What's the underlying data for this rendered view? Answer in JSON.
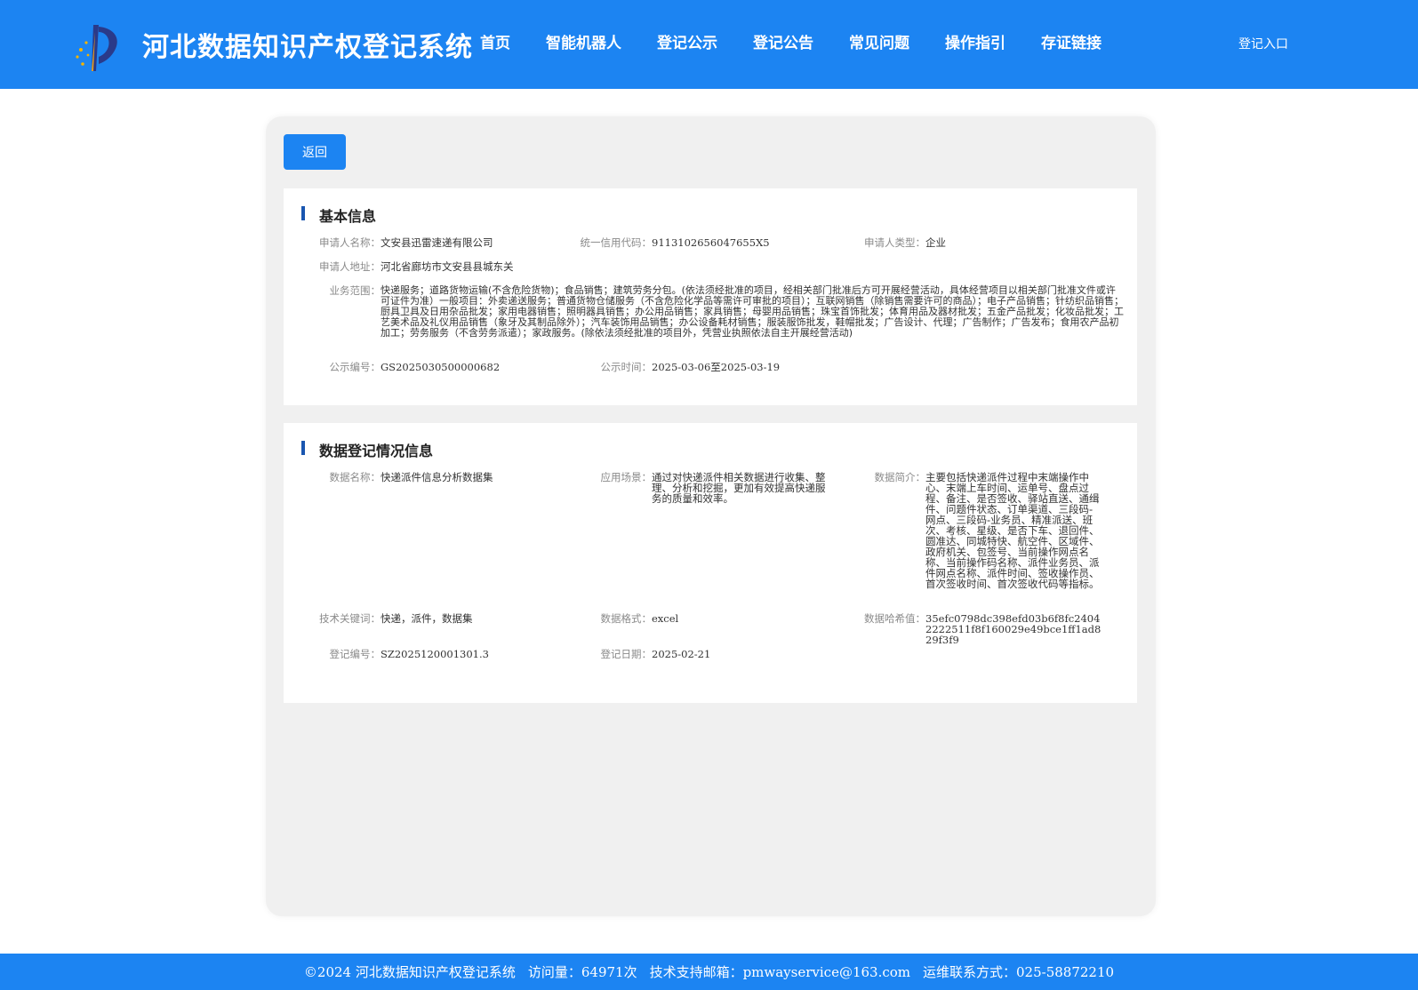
{
  "header": {
    "site_title": "河北数据知识产权登记系统",
    "nav": [
      "首页",
      "智能机器人",
      "登记公示",
      "登记公告",
      "常见问题",
      "操作指引",
      "存证链接"
    ],
    "login": "登记入口"
  },
  "back_label": "返回",
  "basic": {
    "title": "基本信息",
    "applicant_name_label": "申请人名称：",
    "applicant_name": "文安县迅雷速递有限公司",
    "credit_code_label": "统一信用代码：",
    "credit_code": "9113102656047655X5",
    "applicant_type_label": "申请人类型：",
    "applicant_type": "企业",
    "address_label": "申请人地址：",
    "address": "河北省廊坊市文安县县城东关",
    "scope_label": "业务范围：",
    "scope": "快递服务；道路货物运输(不含危险货物)；食品销售；建筑劳务分包。(依法须经批准的项目，经相关部门批准后方可开展经营活动，具体经营项目以相关部门批准文件或许可证件为准）一般项目：外卖递送服务；普通货物仓储服务（不含危险化学品等需许可审批的项目）；互联网销售（除销售需要许可的商品）；电子产品销售；针纺织品销售；厨具卫具及日用杂品批发；家用电器销售；照明器具销售；办公用品销售；家具销售；母婴用品销售；珠宝首饰批发；体育用品及器材批发；五金产品批发；化妆品批发；工艺美术品及礼仪用品销售（象牙及其制品除外）；汽车装饰用品销售；办公设备耗材销售；服装服饰批发，鞋帽批发；广告设计、代理；广告制作；广告发布；食用农产品初加工；劳务服务（不含劳务派遣）；家政服务。(除依法须经批准的项目外，凭营业执照依法自主开展经营活动)",
    "notice_no_label": "公示编号：",
    "notice_no": "GS2025030500000682",
    "notice_time_label": "公示时间：",
    "notice_time": "2025-03-06至2025-03-19"
  },
  "data_info": {
    "title": "数据登记情况信息",
    "data_name_label": "数据名称：",
    "data_name": "快递派件信息分析数据集",
    "scenario_label": "应用场景：",
    "scenario": "通过对快递派件相关数据进行收集、整理、分析和挖掘，更加有效提高快递服务的质量和效率。",
    "intro_label": "数据简介：",
    "intro": "主要包括快递派件过程中末端操作中心、末端上车时间、运单号、盘点过程、备注、是否签收、驿站直送、通缉件、问题件状态、订单渠道、三段码-网点、三段码-业务员、精准派送、班次、考核、星级、是否下车、退回件、圆准达、同城特快、航空件、区域件、政府机关、包签号、当前操作网点名称、当前操作码名称、派件业务员、派件网点名称、派件时间、签收操作员、首次签收时间、首次签收代码等指标。",
    "keywords_label": "技术关键词：",
    "keywords": "快递，派件，数据集",
    "format_label": "数据格式：",
    "format": "excel",
    "hash_label": "数据哈希值：",
    "hash": "35efc0798dc398efd03b6f8fc24042222511f8f160029e49bce1ff1ad829f3f9",
    "reg_no_label": "登记编号：",
    "reg_no": "SZ2025120001301.3",
    "reg_date_label": "登记日期：",
    "reg_date": "2025-02-21"
  },
  "footer": {
    "copyright": "©2024 河北数据知识产权登记系统",
    "visits": "访问量：64971次",
    "email": "技术支持邮箱：pmwayservice@163.com",
    "phone": "运维联系方式：025-58872210"
  },
  "colors": {
    "primary": "#1c84f2",
    "accent_bar": "#1a56b0",
    "card_bg": "#f0f0f0"
  }
}
